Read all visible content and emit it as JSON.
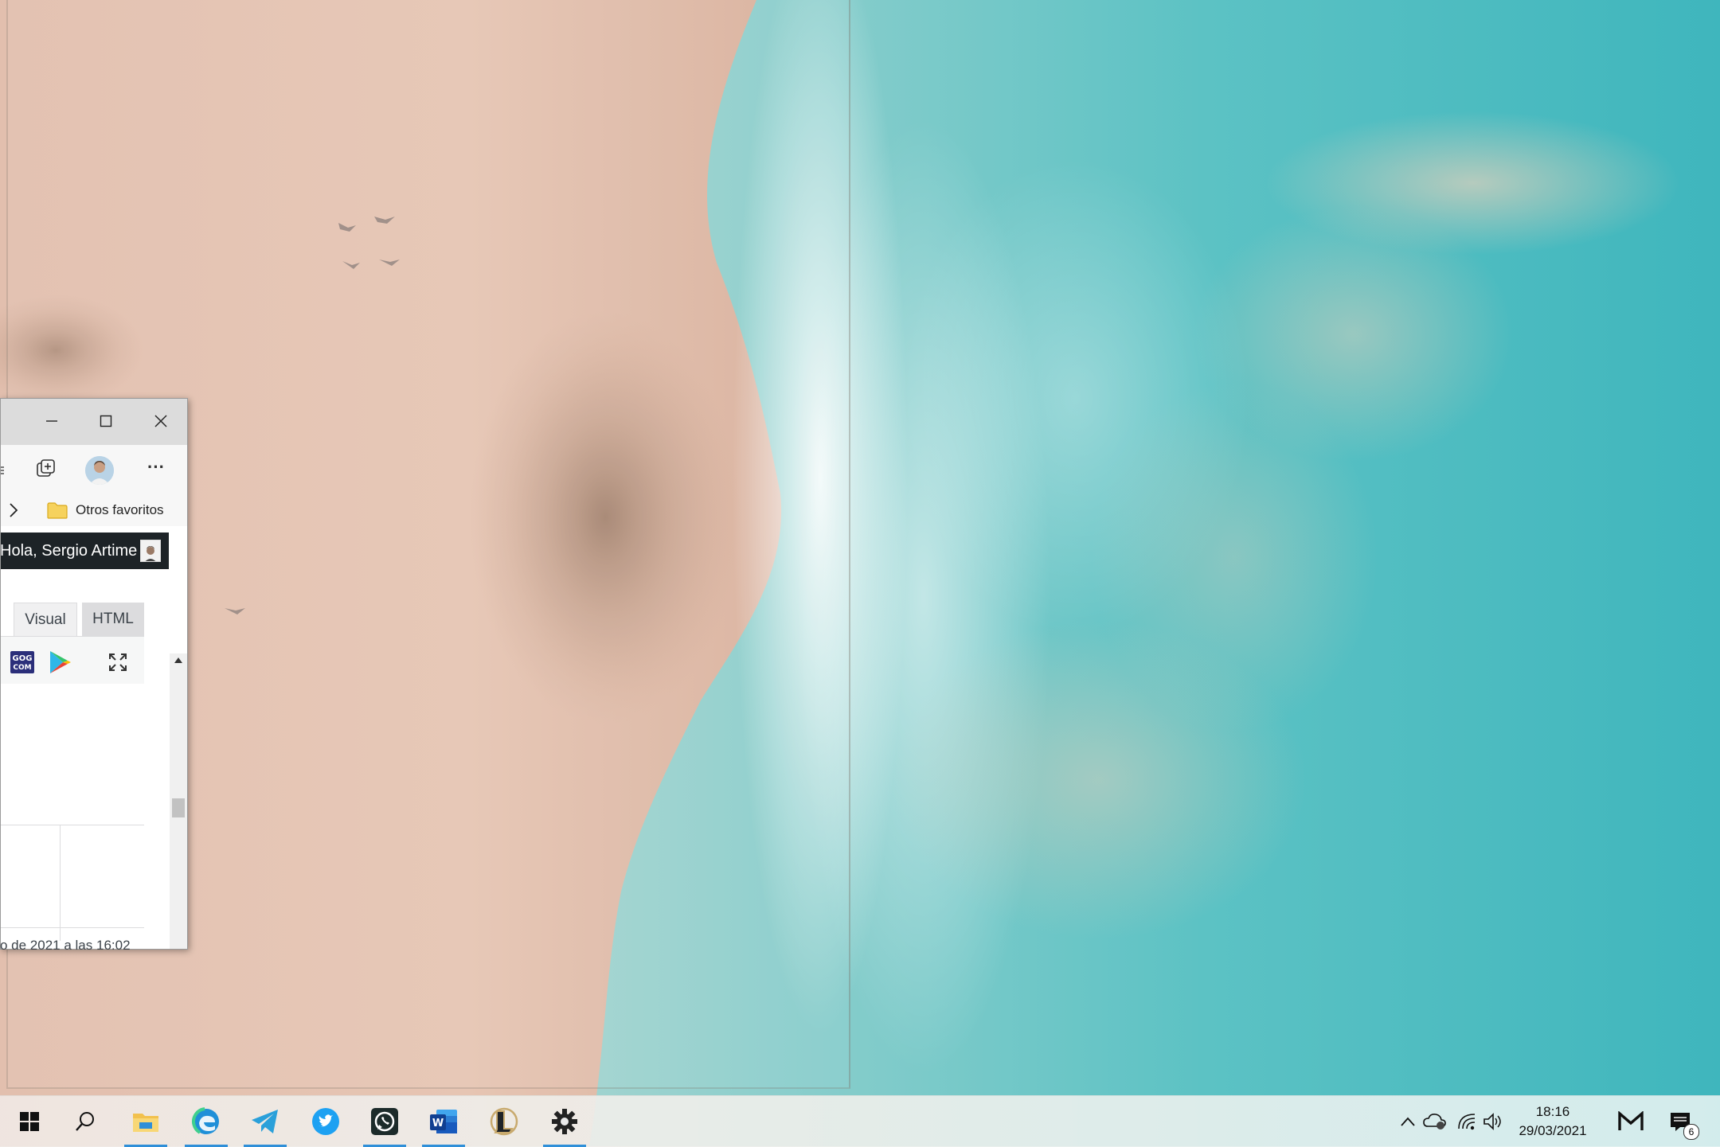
{
  "desktop": {
    "wallpaper": "aerial-beach-ocean"
  },
  "browser": {
    "toolbar": {
      "collections_icon": "collections-icon",
      "more_label": "···"
    },
    "favorites_bar": {
      "folder_label": "Otros favoritos"
    },
    "page": {
      "greeting": "Hola, Sergio Artime",
      "tabs": [
        {
          "label": "Visual"
        },
        {
          "label": "HTML"
        }
      ],
      "footer_text": "o de 2021 a las 16:02"
    }
  },
  "taskbar": {
    "apps": [
      {
        "name": "start",
        "running": false
      },
      {
        "name": "search",
        "running": false
      },
      {
        "name": "file-explorer",
        "running": true
      },
      {
        "name": "edge",
        "running": true
      },
      {
        "name": "telegram",
        "running": true
      },
      {
        "name": "twitter",
        "running": false
      },
      {
        "name": "whatsapp",
        "running": true
      },
      {
        "name": "word",
        "running": true
      },
      {
        "name": "league-of-legends",
        "running": false
      },
      {
        "name": "settings",
        "running": true
      }
    ],
    "clock": {
      "time": "18:16",
      "date": "29/03/2021"
    },
    "notifications": {
      "count": "6"
    }
  },
  "colors": {
    "accent": "#2f8fd8",
    "wp_admin_bar": "#1d2327"
  }
}
